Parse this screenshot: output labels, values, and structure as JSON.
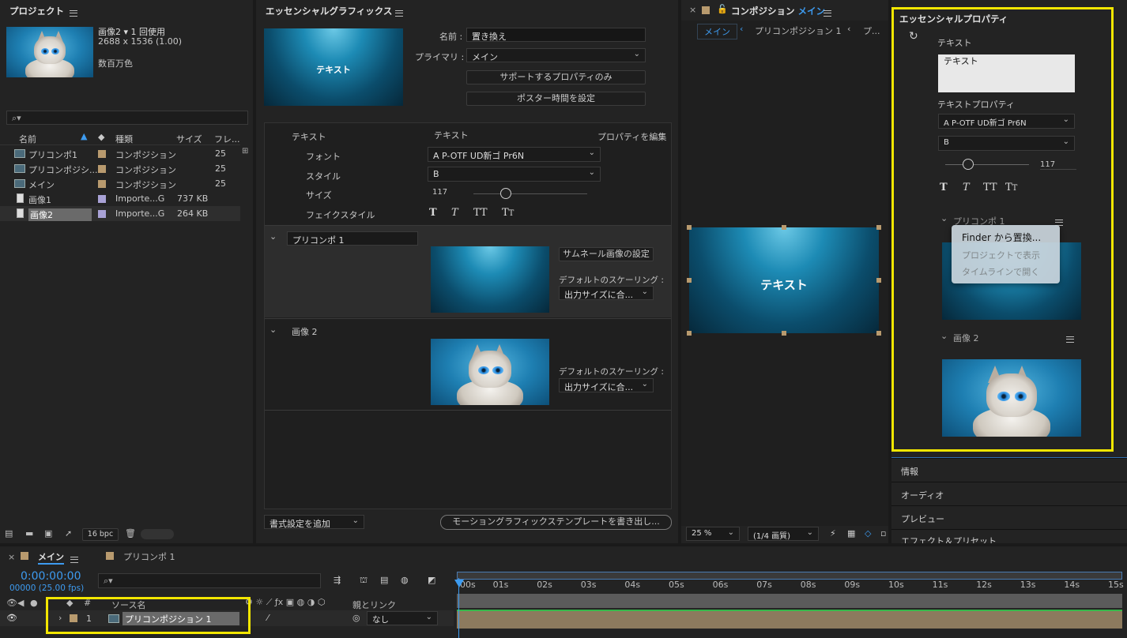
{
  "project": {
    "title": "プロジェクト",
    "item_name": "画像2",
    "usage": "1 回使用",
    "dims": "2688 x 1536 (1.00)",
    "color": "数百万色",
    "search_placeholder": "",
    "columns": {
      "name": "名前",
      "type": "種類",
      "size": "サイズ",
      "fps": "フレ..."
    },
    "items": [
      {
        "name": "プリコンポ1",
        "type": "コンポジション",
        "size": "",
        "fps": "25",
        "color": "#b89a6e",
        "kind": "comp"
      },
      {
        "name": "プリコンポジシ...",
        "type": "コンポジション",
        "size": "",
        "fps": "25",
        "color": "#b89a6e",
        "kind": "comp"
      },
      {
        "name": "メイン",
        "type": "コンポジション",
        "size": "",
        "fps": "25",
        "color": "#b89a6e",
        "kind": "comp"
      },
      {
        "name": "画像1",
        "type": "Importe...G",
        "size": "737 KB",
        "fps": "",
        "color": "#a9a2d6",
        "kind": "file"
      },
      {
        "name": "画像2",
        "type": "Importe...G",
        "size": "264 KB",
        "fps": "",
        "color": "#a9a2d6",
        "kind": "file"
      }
    ],
    "bpc": "16 bpc"
  },
  "eg": {
    "title": "エッセンシャルグラフィックス",
    "thumb_text": "テキスト",
    "name_label": "名前 :",
    "name_value": "置き換え",
    "primary_label": "プライマリ :",
    "primary_value": "メイン",
    "btn_supported": "サポートするプロパティのみ",
    "btn_poster": "ポスター時間を設定",
    "text_section": {
      "label": "テキスト",
      "value": "テキスト",
      "edit_link": "プロパティを編集",
      "font_label": "フォント",
      "font_value": "A P-OTF UD新ゴ Pr6N",
      "style_label": "スタイル",
      "style_value": "B",
      "size_label": "サイズ",
      "size_value": "117",
      "faux_label": "フェイクスタイル"
    },
    "precomp": {
      "name": "プリコンポ 1",
      "thumb_btn": "サムネール画像の設定",
      "scaling_label": "デフォルトのスケーリング :",
      "scaling_value": "出力サイズに合..."
    },
    "image2": {
      "name": "画像 2",
      "scaling_label": "デフォルトのスケーリング :",
      "scaling_value": "出力サイズに合..."
    },
    "add_format": "書式設定を追加",
    "export_btn": "モーショングラフィックステンプレートを書き出し..."
  },
  "comp": {
    "title": "コンポジション",
    "title_blue": "メイン",
    "tab_main": "メイン",
    "tab_precomp": "プリコンポジション 1",
    "tab_more": "プ...",
    "overlay_text": "テキスト",
    "zoom": "25 %",
    "quality": "(1/4 画質)"
  },
  "ep": {
    "title": "エッセンシャルプロパティ",
    "text_label": "テキスト",
    "text_value": "テキスト",
    "textprop_label": "テキストプロパティ",
    "font_value": "A P-OTF UD新ゴ Pr6N",
    "style_value": "B",
    "size_value": "117",
    "precomp_label": "プリコンポ 1",
    "image2_label": "画像 2",
    "context_menu": [
      "Finder から置換...",
      "プロジェクトで表示",
      "タイムラインで開く"
    ]
  },
  "side_tabs": [
    "情報",
    "オーディオ",
    "プレビュー",
    "エフェクト＆プリセット"
  ],
  "timeline": {
    "tab_main": "メイン",
    "tab_precomp": "プリコンポ 1",
    "timecode": "0:00:00:00",
    "frames": "00000 (25.00 fps)",
    "col_source": "ソース名",
    "col_parent": "親とリンク",
    "layer_index": "1",
    "layer_name": "プリコンポジション 1",
    "parent_value": "なし",
    "ruler": [
      "00s",
      "01s",
      "02s",
      "03s",
      "04s",
      "05s",
      "06s",
      "07s",
      "08s",
      "09s",
      "10s",
      "11s",
      "12s",
      "13s",
      "14s",
      "15s"
    ]
  }
}
